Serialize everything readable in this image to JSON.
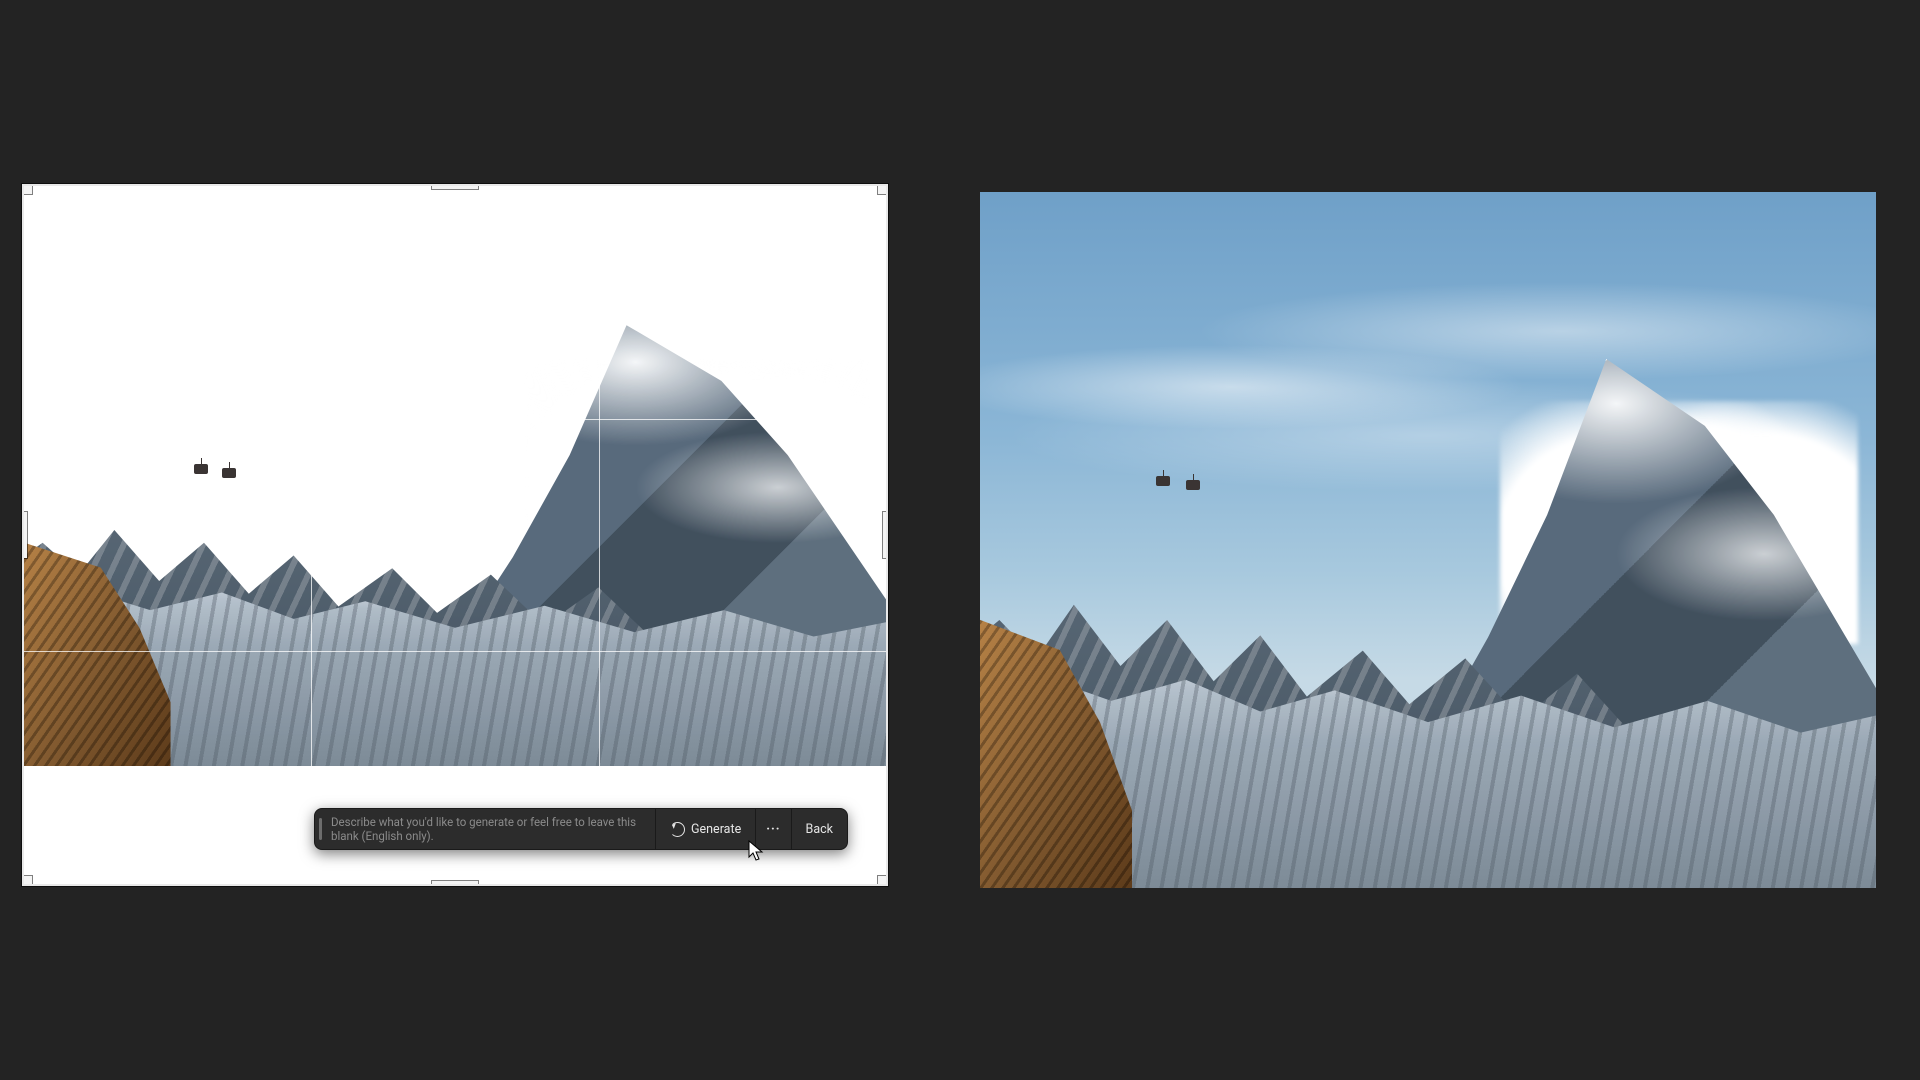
{
  "toolbar": {
    "prompt_placeholder": "Describe what you'd like to generate or feel free to leave this blank (English only).",
    "generate_label": "Generate",
    "more_label": "···",
    "back_label": "Back"
  }
}
